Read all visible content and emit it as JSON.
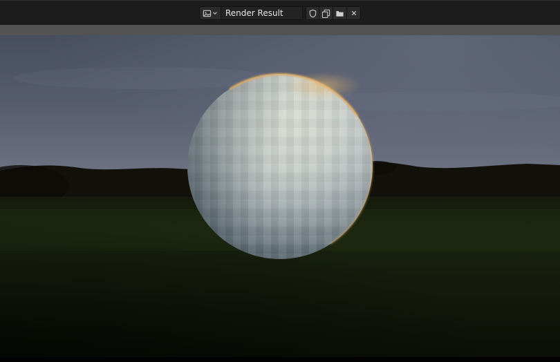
{
  "header": {
    "image_name": "Render Result",
    "controls": [
      {
        "name": "image-type-dropdown",
        "icons": [
          "image-icon",
          "chevron-down-icon"
        ]
      },
      {
        "name": "image-name-field",
        "value": "Render Result"
      },
      {
        "name": "fake-user-toggle",
        "icon": "shield-icon"
      },
      {
        "name": "new-image-button",
        "icon": "duplicate-icon"
      },
      {
        "name": "open-image-button",
        "icon": "folder-icon"
      },
      {
        "name": "unlink-button",
        "icon": "close-icon"
      }
    ]
  },
  "colors": {
    "topbar_bg": "#1c1c1c",
    "button_bg": "#2b2b2b",
    "field_bg": "#232323",
    "field_text": "#e8e8e8",
    "strip_bg": "#535353",
    "sky_top": "#474e5e",
    "sky_bottom": "#7e8290",
    "treeline": "#12110a",
    "ground_dark": "#0b0f07",
    "ground_mid": "#1a220f",
    "sphere_light": "#d8dbd3",
    "sphere_dark": "#2e3b40",
    "rim_light": "#dfa860"
  }
}
